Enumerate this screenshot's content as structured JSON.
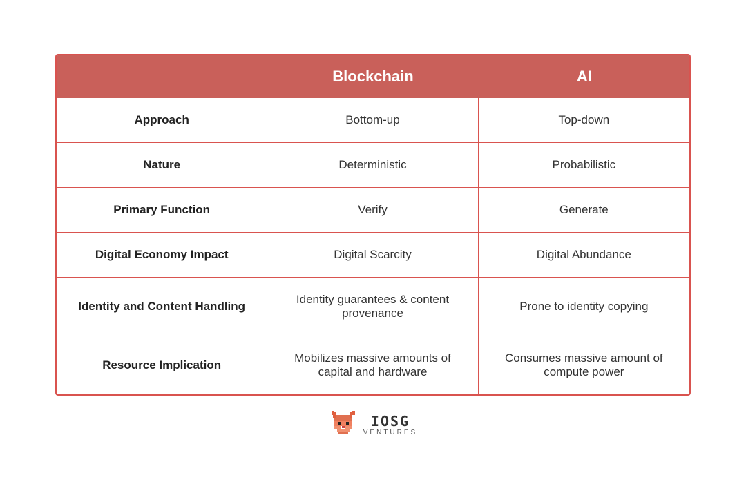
{
  "header": {
    "col1_label": "",
    "col2_label": "Blockchain",
    "col3_label": "AI"
  },
  "rows": [
    {
      "id": "approach",
      "label": "Approach",
      "blockchain": "Bottom-up",
      "ai": "Top-down"
    },
    {
      "id": "nature",
      "label": "Nature",
      "blockchain": "Deterministic",
      "ai": "Probabilistic"
    },
    {
      "id": "primary-function",
      "label": "Primary Function",
      "blockchain": "Verify",
      "ai": "Generate"
    },
    {
      "id": "digital-economy",
      "label": "Digital Economy Impact",
      "blockchain": "Digital Scarcity",
      "ai": "Digital Abundance"
    },
    {
      "id": "identity",
      "label": "Identity and Content Handling",
      "blockchain": "Identity guarantees & content provenance",
      "ai": "Prone to identity copying"
    },
    {
      "id": "resource",
      "label": "Resource Implication",
      "blockchain": "Mobilizes massive amounts of capital and hardware",
      "ai": "Consumes massive amount of compute power"
    }
  ],
  "footer": {
    "logo_main": "IOSG",
    "logo_sub": "VENTURES"
  },
  "colors": {
    "header_bg": "#c9605a",
    "border": "#d9534f",
    "header_text": "#ffffff"
  }
}
